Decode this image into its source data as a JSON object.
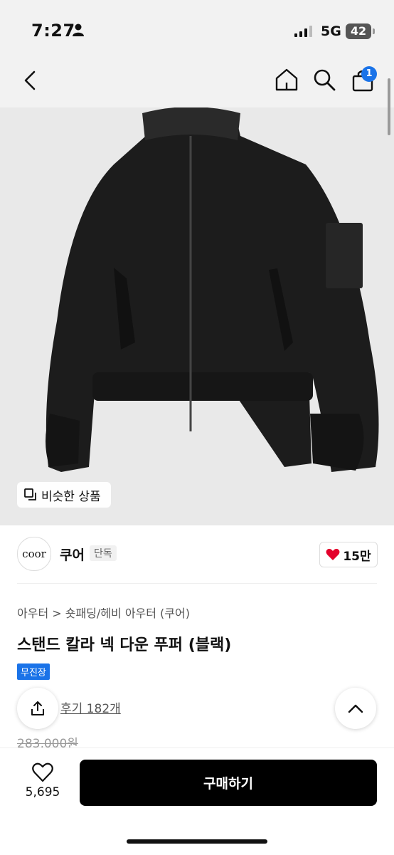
{
  "status": {
    "time": "7:27",
    "network": "5G",
    "battery": "42"
  },
  "nav": {
    "cart_count": "1"
  },
  "hero": {
    "similar_label": "비슷한 상품"
  },
  "brand": {
    "logo_text": "coor",
    "name": "쿠어",
    "tag": "단독",
    "likes": "15만"
  },
  "product": {
    "breadcrumb": "아우터 > 숏패딩/헤비 아우터 (쿠어)",
    "title": "스탠드 칼라 넥 다운 푸퍼 (블랙)",
    "ship_tag": "무진장",
    "review": "후기 182개",
    "original_price": "283,000원"
  },
  "footer": {
    "heart_count": "5,695",
    "buy_label": "구매하기"
  },
  "colors": {
    "accent": "#1a73e8",
    "heart": "#e4002b",
    "buy_bg": "#000000"
  },
  "icons": [
    "person-icon",
    "signal-icon",
    "back-icon",
    "home-icon",
    "search-icon",
    "cart-icon",
    "similar-icon",
    "heart-icon",
    "share-icon",
    "chevron-up-icon"
  ]
}
